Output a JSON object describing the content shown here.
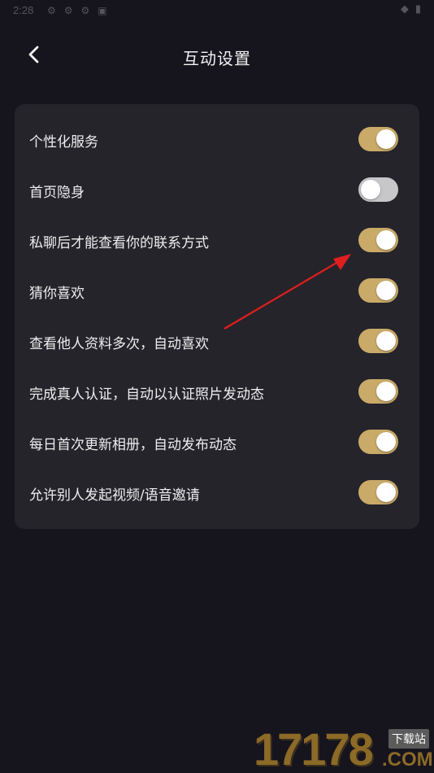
{
  "status_bar": {
    "time": "2:28",
    "icons": [
      "settings-icon",
      "settings-icon",
      "settings-icon",
      "notification-icon"
    ],
    "right_icons": [
      "wifi-icon",
      "battery-icon"
    ]
  },
  "header": {
    "back_icon": "chevron-left-icon",
    "title": "互动设置"
  },
  "settings": [
    {
      "label": "个性化服务",
      "enabled": true
    },
    {
      "label": "首页隐身",
      "enabled": false
    },
    {
      "label": "私聊后才能查看你的联系方式",
      "enabled": true
    },
    {
      "label": "猜你喜欢",
      "enabled": true
    },
    {
      "label": "查看他人资料多次，自动喜欢",
      "enabled": true
    },
    {
      "label": "完成真人认证，自动以认证照片发动态",
      "enabled": true
    },
    {
      "label": "每日首次更新相册，自动发布动态",
      "enabled": true
    },
    {
      "label": "允许别人发起视频/语音邀请",
      "enabled": true
    }
  ],
  "colors": {
    "toggle_on": "#c9aa68",
    "toggle_off": "#c7c7ca",
    "card": "#25242b",
    "background": "#16141d",
    "annotation_arrow": "#e01e1e"
  },
  "watermark": {
    "digits": "17178",
    "site": "下载站",
    "domain": ".COM"
  }
}
